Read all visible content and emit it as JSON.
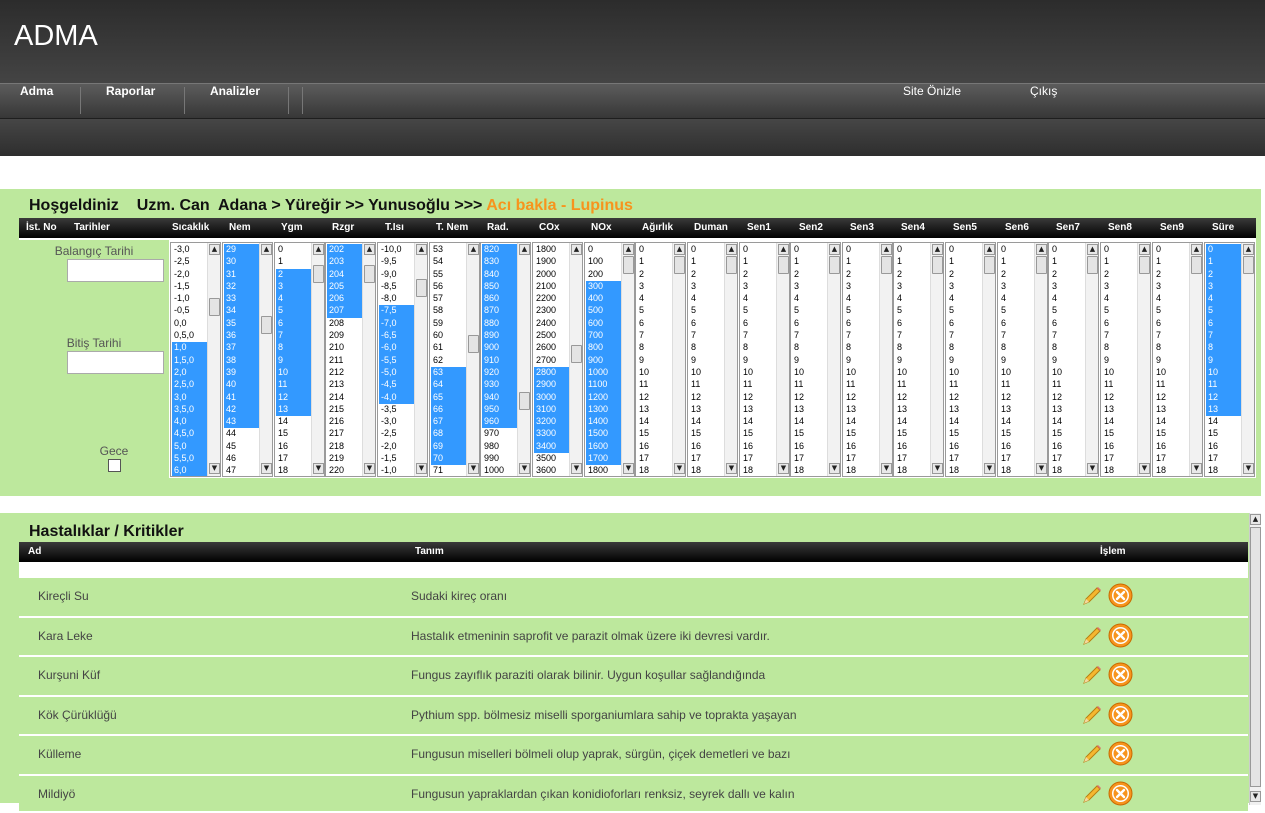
{
  "app": {
    "logo": "ADMA"
  },
  "nav": {
    "items": [
      "Adma",
      "Raporlar",
      "Analizler"
    ],
    "site_preview": "Site Önizle",
    "logout": "Çıkış"
  },
  "welcome": {
    "greeting": "Hoşgeldiniz",
    "user": "Uzm. Can",
    "location": "Adana > Yüreğir >> Yunusoğlu >>>",
    "plant": "Acı bakla - Lupinus"
  },
  "filter_table": {
    "columns": [
      "İst. No",
      "Tarihler",
      "Sıcaklık",
      "Nem",
      "Ygm",
      "Rzgr",
      "T.Isı",
      "T. Nem",
      "Rad.",
      "COx",
      "NOx",
      "Ağırlık",
      "Duman",
      "Sen1",
      "Sen2",
      "Sen3",
      "Sen4",
      "Sen5",
      "Sen6",
      "Sen7",
      "Sen8",
      "Sen9",
      "Süre"
    ],
    "start_date_label": "Balangıç Tarihi",
    "start_date_value": "",
    "end_date_label": "Bitiş Tarihi",
    "end_date_value": "",
    "night_label": "Gece",
    "night_checked": false,
    "lists": [
      {
        "name": "sicaklik",
        "options": [
          "-3,0",
          "-2,5",
          "-2,0",
          "-1,5",
          "-1,0",
          "-0,5",
          "0,0",
          "0,5,0",
          "1,0",
          "1,5,0",
          "2,0",
          "2,5,0",
          "3,0",
          "3,5,0",
          "4,0",
          "4,5,0",
          "5,0",
          "5,5,0",
          "6,0"
        ],
        "selected": [
          "1,0",
          "1,5,0",
          "2,0",
          "2,5,0",
          "3,0",
          "3,5,0",
          "4,0",
          "4,5,0",
          "5,0",
          "5,5,0",
          "6,0"
        ],
        "scroll": 0.22
      },
      {
        "name": "nem",
        "options": [
          "29",
          "30",
          "31",
          "32",
          "33",
          "34",
          "35",
          "36",
          "37",
          "38",
          "39",
          "40",
          "41",
          "42",
          "43",
          "44",
          "45",
          "46",
          "47"
        ],
        "selected": [
          "29",
          "30",
          "31",
          "32",
          "33",
          "34",
          "35",
          "36",
          "37",
          "38",
          "39",
          "40",
          "41",
          "42",
          "43"
        ],
        "scroll": 0.32
      },
      {
        "name": "ygm",
        "options": [
          "0",
          "1",
          "2",
          "3",
          "4",
          "5",
          "6",
          "7",
          "8",
          "9",
          "10",
          "11",
          "12",
          "13",
          "14",
          "15",
          "16",
          "17",
          "18"
        ],
        "selected": [
          "2",
          "3",
          "4",
          "5",
          "6",
          "7",
          "8",
          "9",
          "10",
          "11",
          "12",
          "13"
        ],
        "scroll": 0.05
      },
      {
        "name": "rzgr",
        "options": [
          "202",
          "203",
          "204",
          "205",
          "206",
          "207",
          "208",
          "209",
          "210",
          "211",
          "212",
          "213",
          "214",
          "215",
          "216",
          "217",
          "218",
          "219",
          "220"
        ],
        "selected": [
          "202",
          "203",
          "204",
          "205",
          "206",
          "207"
        ],
        "scroll": 0.05
      },
      {
        "name": "tisi",
        "options": [
          "-10,0",
          "-9,5",
          "-9,0",
          "-8,5",
          "-8,0",
          "-7,5",
          "-7,0",
          "-6,5",
          "-6,0",
          "-5,5",
          "-5,0",
          "-4,5",
          "-4,0",
          "-3,5",
          "-3,0",
          "-2,5",
          "-2,0",
          "-1,5",
          "-1,0"
        ],
        "selected": [
          "-7,5",
          "-7,0",
          "-6,5",
          "-6,0",
          "-5,5",
          "-5,0",
          "-4,5",
          "-4,0"
        ],
        "scroll": 0.12
      },
      {
        "name": "tnem",
        "options": [
          "53",
          "54",
          "55",
          "56",
          "57",
          "58",
          "59",
          "60",
          "61",
          "62",
          "63",
          "64",
          "65",
          "66",
          "67",
          "68",
          "69",
          "70",
          "71"
        ],
        "selected": [
          "63",
          "64",
          "65",
          "66",
          "67",
          "68",
          "69",
          "70"
        ],
        "scroll": 0.42
      },
      {
        "name": "rad",
        "options": [
          "820",
          "830",
          "840",
          "850",
          "860",
          "870",
          "880",
          "890",
          "900",
          "910",
          "920",
          "930",
          "940",
          "950",
          "960",
          "970",
          "980",
          "990",
          "1000"
        ],
        "selected": [
          "820",
          "830",
          "840",
          "850",
          "860",
          "870",
          "880",
          "890",
          "900",
          "910",
          "920",
          "930",
          "940",
          "950",
          "960"
        ],
        "scroll": 0.72
      },
      {
        "name": "cox",
        "options": [
          "1800",
          "1900",
          "2000",
          "2100",
          "2200",
          "2300",
          "2400",
          "2500",
          "2600",
          "2700",
          "2800",
          "2900",
          "3000",
          "3100",
          "3200",
          "3300",
          "3400",
          "3500",
          "3600"
        ],
        "selected": [
          "2800",
          "2900",
          "3000",
          "3100",
          "3200",
          "3300",
          "3400"
        ],
        "scroll": 0.47
      },
      {
        "name": "nox",
        "options": [
          "0",
          "100",
          "200",
          "300",
          "400",
          "500",
          "600",
          "700",
          "800",
          "900",
          "1000",
          "1100",
          "1200",
          "1300",
          "1400",
          "1500",
          "1600",
          "1700",
          "1800"
        ],
        "selected": [
          "300",
          "400",
          "500",
          "600",
          "700",
          "800",
          "900",
          "1000",
          "1100",
          "1200",
          "1300",
          "1400",
          "1500",
          "1600",
          "1700"
        ],
        "scroll": 0.0
      },
      {
        "name": "agirlik",
        "options": [
          "0",
          "1",
          "2",
          "3",
          "4",
          "5",
          "6",
          "7",
          "8",
          "9",
          "10",
          "11",
          "12",
          "13",
          "14",
          "15",
          "16",
          "17",
          "18"
        ],
        "selected": [],
        "scroll": 0.0
      },
      {
        "name": "duman",
        "options": [
          "0",
          "1",
          "2",
          "3",
          "4",
          "5",
          "6",
          "7",
          "8",
          "9",
          "10",
          "11",
          "12",
          "13",
          "14",
          "15",
          "16",
          "17",
          "18"
        ],
        "selected": [],
        "scroll": 0.0
      },
      {
        "name": "sen1",
        "options": [
          "0",
          "1",
          "2",
          "3",
          "4",
          "5",
          "6",
          "7",
          "8",
          "9",
          "10",
          "11",
          "12",
          "13",
          "14",
          "15",
          "16",
          "17",
          "18"
        ],
        "selected": [],
        "scroll": 0.0
      },
      {
        "name": "sen2",
        "options": [
          "0",
          "1",
          "2",
          "3",
          "4",
          "5",
          "6",
          "7",
          "8",
          "9",
          "10",
          "11",
          "12",
          "13",
          "14",
          "15",
          "16",
          "17",
          "18"
        ],
        "selected": [],
        "scroll": 0.0
      },
      {
        "name": "sen3",
        "options": [
          "0",
          "1",
          "2",
          "3",
          "4",
          "5",
          "6",
          "7",
          "8",
          "9",
          "10",
          "11",
          "12",
          "13",
          "14",
          "15",
          "16",
          "17",
          "18"
        ],
        "selected": [],
        "scroll": 0.0
      },
      {
        "name": "sen4",
        "options": [
          "0",
          "1",
          "2",
          "3",
          "4",
          "5",
          "6",
          "7",
          "8",
          "9",
          "10",
          "11",
          "12",
          "13",
          "14",
          "15",
          "16",
          "17",
          "18"
        ],
        "selected": [],
        "scroll": 0.0
      },
      {
        "name": "sen5",
        "options": [
          "0",
          "1",
          "2",
          "3",
          "4",
          "5",
          "6",
          "7",
          "8",
          "9",
          "10",
          "11",
          "12",
          "13",
          "14",
          "15",
          "16",
          "17",
          "18"
        ],
        "selected": [],
        "scroll": 0.0
      },
      {
        "name": "sen6",
        "options": [
          "0",
          "1",
          "2",
          "3",
          "4",
          "5",
          "6",
          "7",
          "8",
          "9",
          "10",
          "11",
          "12",
          "13",
          "14",
          "15",
          "16",
          "17",
          "18"
        ],
        "selected": [],
        "scroll": 0.0
      },
      {
        "name": "sen7",
        "options": [
          "0",
          "1",
          "2",
          "3",
          "4",
          "5",
          "6",
          "7",
          "8",
          "9",
          "10",
          "11",
          "12",
          "13",
          "14",
          "15",
          "16",
          "17",
          "18"
        ],
        "selected": [],
        "scroll": 0.0
      },
      {
        "name": "sen8",
        "options": [
          "0",
          "1",
          "2",
          "3",
          "4",
          "5",
          "6",
          "7",
          "8",
          "9",
          "10",
          "11",
          "12",
          "13",
          "14",
          "15",
          "16",
          "17",
          "18"
        ],
        "selected": [],
        "scroll": 0.0
      },
      {
        "name": "sen9",
        "options": [
          "0",
          "1",
          "2",
          "3",
          "4",
          "5",
          "6",
          "7",
          "8",
          "9",
          "10",
          "11",
          "12",
          "13",
          "14",
          "15",
          "16",
          "17",
          "18"
        ],
        "selected": [],
        "scroll": 0.0
      },
      {
        "name": "sure",
        "options": [
          "0",
          "1",
          "2",
          "3",
          "4",
          "5",
          "6",
          "7",
          "8",
          "9",
          "10",
          "11",
          "12",
          "13",
          "14",
          "15",
          "16",
          "17",
          "18"
        ],
        "selected": [
          "0",
          "1",
          "2",
          "3",
          "4",
          "5",
          "6",
          "7",
          "8",
          "9",
          "10",
          "11",
          "12",
          "13"
        ],
        "scroll": 0.0
      }
    ]
  },
  "diseases": {
    "title": "Hastalıklar / Kritikler",
    "columns": {
      "name": "Ad",
      "desc": "Tanım",
      "action": "İşlem"
    },
    "rows": [
      {
        "name": "Kireçli Su",
        "desc": "Sudaki kireç oranı"
      },
      {
        "name": "Kara Leke",
        "desc": "Hastalık etmeninin saprofit ve parazit olmak üzere iki devresi vardır."
      },
      {
        "name": "Kurşuni Küf",
        "desc": "Fungus zayıflık paraziti olarak bilinir. Uygun koşullar sağlandığında"
      },
      {
        "name": "Kök Çürüklüğü",
        "desc": "Pythium spp. bölmesiz miselli sporganiumlara sahip ve toprakta yaşayan"
      },
      {
        "name": "Külleme",
        "desc": "Fungusun miselleri bölmeli olup yaprak, sürgün, çiçek demetleri ve bazı"
      },
      {
        "name": "Mildiyö",
        "desc": "Fungusun yapraklardan çıkan konidioforları renksiz, seyrek dallı ve kalın"
      }
    ]
  },
  "colors": {
    "panel_green": "#bde89d",
    "header_dark": "#3f3f3f",
    "accent_orange": "#f7941d",
    "select_blue": "#3399ff",
    "delete_orange": "#f7941d"
  },
  "icons": {
    "edit": "pencil-icon",
    "delete": "close-circle-icon"
  }
}
